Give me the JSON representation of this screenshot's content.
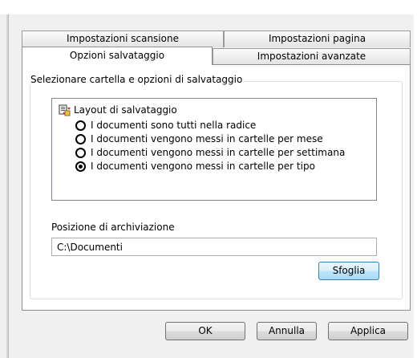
{
  "tabs": {
    "back_row": [
      "Impostazioni scansione",
      "Impostazioni pagina"
    ],
    "front_row": [
      "Opzioni salvataggio",
      "Impostazioni avanzate"
    ],
    "selected": "Opzioni salvataggio"
  },
  "group": {
    "caption": "Selezionare cartella e opzioni di salvataggio"
  },
  "layout": {
    "title": "Layout di salvataggio",
    "options": [
      {
        "label": "I documenti sono tutti nella radice",
        "selected": false
      },
      {
        "label": "I documenti vengono messi in cartelle per mese",
        "selected": false
      },
      {
        "label": "I documenti vengono messi in cartelle per settimana",
        "selected": false
      },
      {
        "label": "I documenti vengono messi in cartelle per tipo",
        "selected": true
      }
    ]
  },
  "archive": {
    "label": "Posizione di archiviazione",
    "value": "C:\\Documenti",
    "browse_label": "Sfoglia"
  },
  "footer": {
    "ok_label": "OK",
    "cancel_label": "Annulla",
    "apply_label": "Applica"
  },
  "colors": {
    "dialog_bg": "#f0f0f0",
    "panel_bg": "#ffffff",
    "focus_border": "#3c7fb1"
  }
}
